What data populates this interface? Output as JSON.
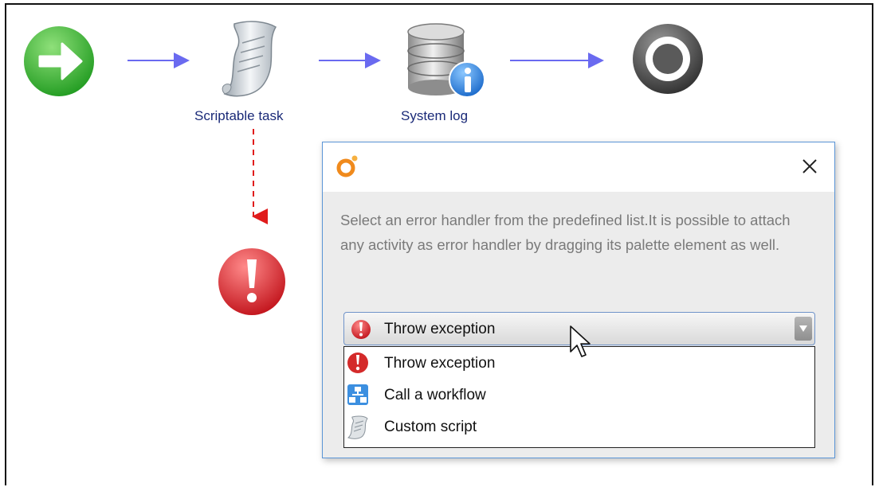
{
  "flow": {
    "nodes": [
      {
        "id": "start",
        "icon": "start-arrow-icon",
        "label": ""
      },
      {
        "id": "scriptable-task",
        "icon": "script-scroll-icon",
        "label": "Scriptable task"
      },
      {
        "id": "system-log",
        "icon": "database-info-icon",
        "label": "System log"
      },
      {
        "id": "end",
        "icon": "end-target-icon",
        "label": ""
      },
      {
        "id": "error-handler",
        "icon": "error-exclamation-icon",
        "label": ""
      }
    ],
    "colors": {
      "connector": "#6a6af0",
      "error_connector": "#e01b1b"
    }
  },
  "dialog": {
    "logo_icon": "orchestrator-logo-icon",
    "close_glyph": "✕",
    "description": "Select an error handler from the predefined list.It is possible to attach any activity as error handler by dragging its palette element as well.",
    "combo": {
      "selected": "Throw exception",
      "selected_icon": "error-exclamation-icon"
    },
    "options": [
      {
        "label": "Throw exception",
        "icon": "error-exclamation-icon"
      },
      {
        "label": "Call a workflow",
        "icon": "workflow-icon"
      },
      {
        "label": "Custom script",
        "icon": "script-scroll-icon"
      }
    ]
  }
}
